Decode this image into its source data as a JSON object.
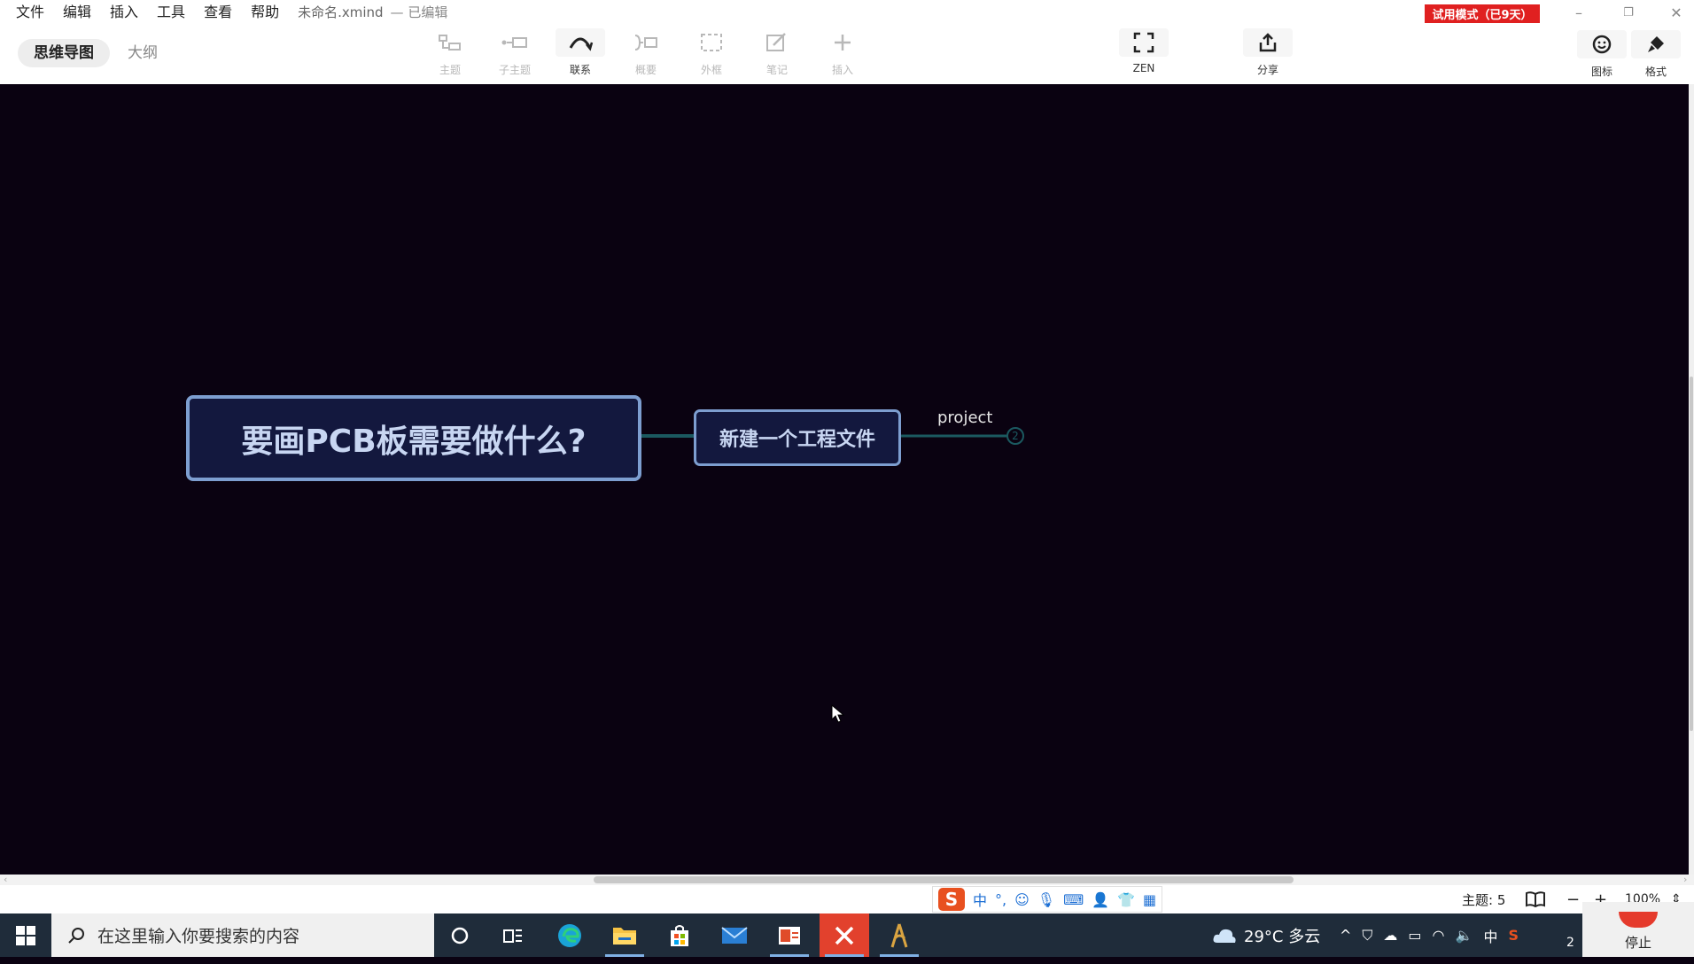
{
  "menu": {
    "items": [
      "文件",
      "编辑",
      "插入",
      "工具",
      "查看",
      "帮助"
    ],
    "doc_title": "未命名.xmind",
    "doc_status": "— 已编辑"
  },
  "trial_badge": "试用模式（已9天）",
  "window_controls": {
    "minimize": "–",
    "restore": "❐",
    "close": "✕"
  },
  "view_tabs": {
    "mindmap": "思维导图",
    "outline": "大纲"
  },
  "toolbar": {
    "topic": "主题",
    "subtopic": "子主题",
    "relationship": "联系",
    "summary": "概要",
    "boundary": "外框",
    "note": "笔记",
    "insert": "插入",
    "zen": "ZEN",
    "share": "分享",
    "icon_panel": "图标",
    "format_panel": "格式"
  },
  "mindmap": {
    "central_topic": "要画PCB板需要做什么?",
    "main_topic": "新建一个工程文件",
    "subtopic_label": "project",
    "collapsed_count": "2"
  },
  "status": {
    "topic_count": "主题: 5",
    "zoom": "100%"
  },
  "ime": {
    "logo": "S",
    "mode": "中",
    "punct": "°,"
  },
  "taskbar": {
    "search_placeholder": "在这里输入你要搜索的内容",
    "weather": "29°C 多云",
    "ime_indicator": "中",
    "clock_fragment": "2",
    "stop_label": "停止"
  },
  "colors": {
    "canvas_bg": "#0a0211",
    "topic_fill": "#13183e",
    "topic_border": "#7d9ed0",
    "connector": "#1b5960",
    "trial_red": "#e02020"
  }
}
